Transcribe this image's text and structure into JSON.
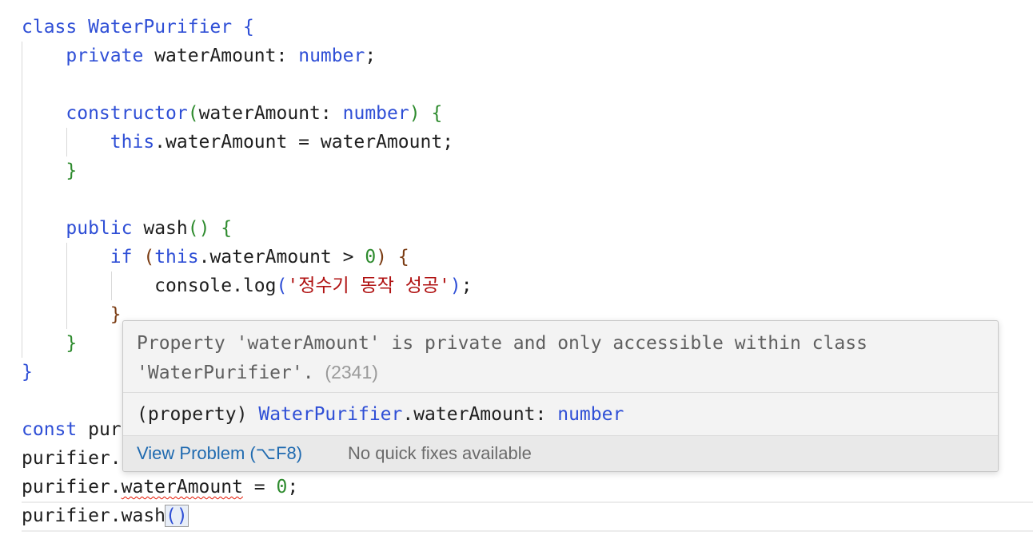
{
  "code": {
    "line1": {
      "kw": "class",
      "name": "WaterPurifier",
      "brace": "{"
    },
    "line2": {
      "kw": "private",
      "name": "waterAmount",
      "colon": ":",
      "type": "number",
      "semi": ";"
    },
    "line4": {
      "kw": "constructor",
      "open": "(",
      "param": "waterAmount",
      "colon": ":",
      "type": "number",
      "close": ")",
      "brace": "{"
    },
    "line5": {
      "kw": "this",
      "rest": ".waterAmount = waterAmount;"
    },
    "line6": {
      "brace": "}"
    },
    "line8": {
      "kw": "public",
      "name": "wash",
      "parens": "()",
      "brace": "{"
    },
    "line9": {
      "kw": "if",
      "open": "(",
      "this": "this",
      "rest": ".waterAmount > ",
      "num": "0",
      "close": ")",
      "brace": "{"
    },
    "line10": {
      "obj": "console.log",
      "open": "(",
      "str": "'정수기 동작 성공'",
      "close": ")",
      "semi": ";"
    },
    "line11": {
      "brace": "}"
    },
    "line12": {
      "brace": "}"
    },
    "line13": {
      "brace": "}"
    },
    "line15": {
      "kw": "const",
      "rest": "pur"
    },
    "line16": {
      "text": "purifier."
    },
    "line17": {
      "obj": "purifier.",
      "prop": "waterAmount",
      "rest": " = ",
      "num": "0",
      "semi": ";"
    },
    "line18": {
      "obj": "purifier.wash",
      "parens": "()"
    }
  },
  "hover": {
    "message": "Property 'waterAmount' is private and only accessible within class 'WaterPurifier'.",
    "code": "(2341)",
    "signature": {
      "kind": "(property)",
      "cls": "WaterPurifier",
      "member": ".waterAmount:",
      "type": "number"
    },
    "view_problem": "View Problem (⌥F8)",
    "no_fixes": "No quick fixes available"
  },
  "colors": {
    "keyword": "#2f4fd6",
    "bracket_green": "#2e8b2e",
    "bracket_brown": "#7a3b12",
    "error": "#e51400",
    "link": "#1f6ab0"
  }
}
